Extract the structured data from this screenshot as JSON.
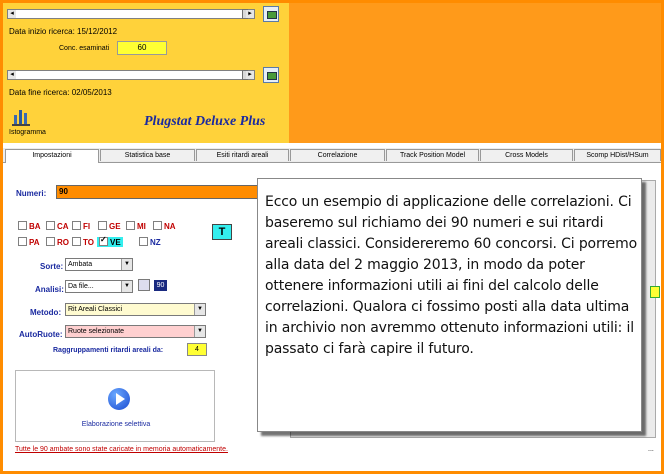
{
  "top": {
    "data_inizio_label": "Data inizio ricerca: 15/12/2012",
    "concorsi_label": "Conc. esaminati",
    "concorsi_value": "60",
    "data_fine_label": "Data fine ricerca: 02/05/2013",
    "istogramma_label": "Istogramma",
    "brand": "Plugstat Deluxe Plus",
    "slider_left": "◂",
    "slider_right": "▸"
  },
  "tabs": [
    {
      "label": "Impostazioni"
    },
    {
      "label": "Statistica base"
    },
    {
      "label": "Esiti ritardi areali"
    },
    {
      "label": "Correlazione"
    },
    {
      "label": "Track Position Model"
    },
    {
      "label": "Cross Models"
    },
    {
      "label": "Scomp HDist/HSum"
    }
  ],
  "form": {
    "numeri_label": "Numeri:",
    "numeri_value": "90",
    "ruote": [
      {
        "label": "BA",
        "checked": false
      },
      {
        "label": "CA",
        "checked": false
      },
      {
        "label": "FI",
        "checked": false
      },
      {
        "label": "GE",
        "checked": false
      },
      {
        "label": "MI",
        "checked": false
      },
      {
        "label": "NA",
        "checked": false
      },
      {
        "label": "PA",
        "checked": false
      },
      {
        "label": "RO",
        "checked": false
      },
      {
        "label": "TO",
        "checked": false
      },
      {
        "label": "VE",
        "checked": true
      },
      {
        "label": "NZ",
        "checked": false
      }
    ],
    "t_button": "T",
    "sorte_label": "Sorte:",
    "sorte_value": "Ambata",
    "analisi_label": "Analisi:",
    "analisi_value": "Da file...",
    "analisi_count": "90",
    "metodo_label": "Metodo:",
    "metodo_value": "Rit Areali Classici",
    "autoruote_label": "AutoRuote:",
    "autoruote_value": "Ruote selezionate",
    "raggruppamenti_label": "Raggruppamenti ritardi areali da:",
    "raggruppamenti_value": "4",
    "elaborazione_label": "Elaborazione selettiva",
    "status": "Tutte le 90 ambate sono state caricate in memoria automaticamente."
  },
  "callout": {
    "text": "Ecco un esempio di applicazione delle correlazioni. Ci baseremo sul richiamo dei 90 numeri e sui ritardi areali classici. Considereremo 60 concorsi. Ci porremo alla data del 2 maggio 2013, in modo da poter ottenere informazioni utili ai fini del calcolo delle correlazioni. Qualora ci fossimo posti alla data ultima in archivio non avremmo ottenuto informazioni utili: il passato ci farà capire il futuro."
  },
  "misc": {
    "ellipsis": "..."
  },
  "colors": {
    "frame": "#ff8c00",
    "top_panel": "#ffd23a",
    "highlight_yellow": "#ffff33",
    "brand_blue": "#1a2aa0",
    "ruota_red": "#c00000",
    "cyan": "#33eeee"
  }
}
